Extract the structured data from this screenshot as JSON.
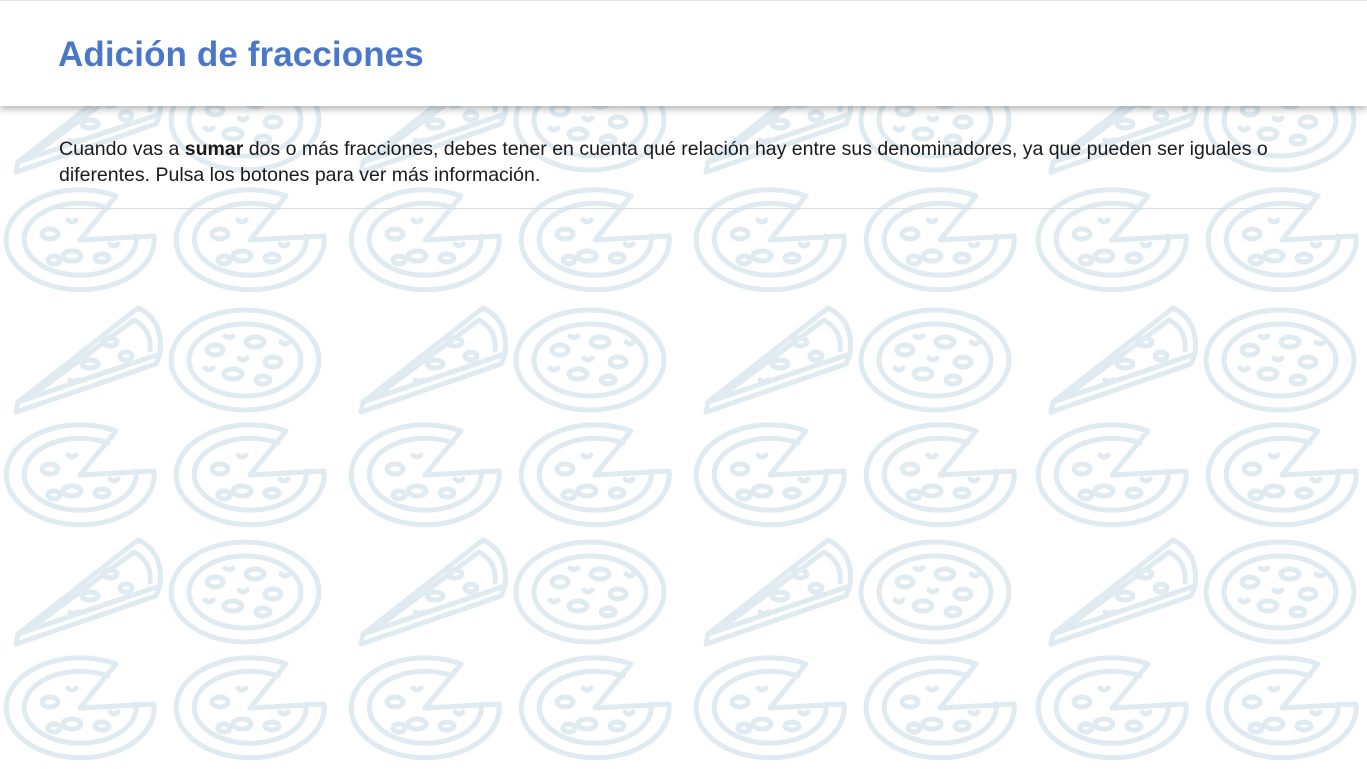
{
  "header": {
    "title": "Adición de fracciones"
  },
  "intro": {
    "part1": "Cuando vas a ",
    "bold": "sumar",
    "part2": " dos o más fracciones, debes tener en cuenta qué relación hay entre sus denominadores, ya que pueden ser iguales o diferentes. Pulsa los botones para ver más información."
  },
  "theme": {
    "title_color": "#4b77c8",
    "pattern_color": "#dfeaf1",
    "text_color": "#1a1a1a"
  },
  "background": {
    "pattern_icon": "pizza-icon"
  }
}
